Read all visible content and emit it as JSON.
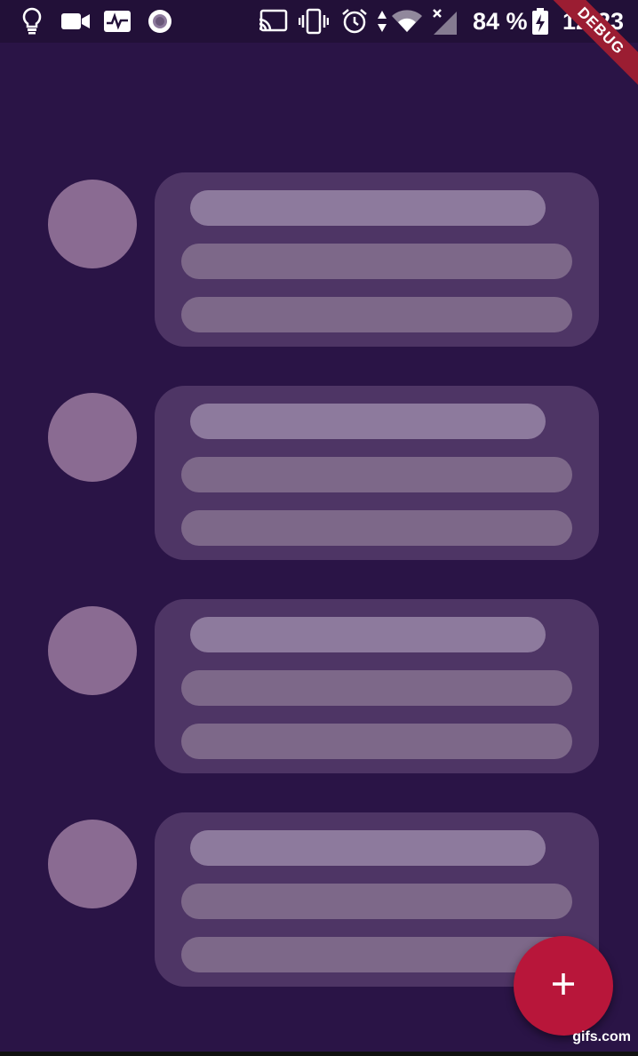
{
  "status_bar": {
    "battery_percent": "84 %",
    "time": "12:23",
    "icons": [
      "lightbulb-icon",
      "video-camera-icon",
      "activity-icon",
      "record-icon",
      "cast-icon",
      "vibrate-icon",
      "alarm-icon",
      "data-arrows-icon",
      "wifi-icon",
      "no-signal-icon",
      "battery-charging-icon"
    ]
  },
  "debug_banner": {
    "label": "DEBUG"
  },
  "list": {
    "items": [
      {
        "kind": "skeleton"
      },
      {
        "kind": "skeleton"
      },
      {
        "kind": "skeleton"
      },
      {
        "kind": "skeleton"
      }
    ]
  },
  "fab": {
    "icon": "plus-icon",
    "color": "#b8163a"
  },
  "watermark": {
    "label": "gifs.com"
  },
  "colors": {
    "background": "#2a1446",
    "card": "#4e3565",
    "avatar": "#8a6b92",
    "bar_title": "#8d7a9d",
    "bar_line": "#7d6889",
    "accent": "#b8163a"
  }
}
